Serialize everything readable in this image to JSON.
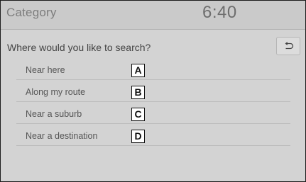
{
  "header": {
    "title": "Category",
    "clock": "6:40"
  },
  "prompt": "Where would you like to search?",
  "back_button": {
    "icon": "back-arrow-icon"
  },
  "options": [
    {
      "label": "Near here",
      "callout": "A"
    },
    {
      "label": "Along my route",
      "callout": "B"
    },
    {
      "label": "Near a suburb",
      "callout": "C"
    },
    {
      "label": "Near a destination",
      "callout": "D"
    }
  ]
}
